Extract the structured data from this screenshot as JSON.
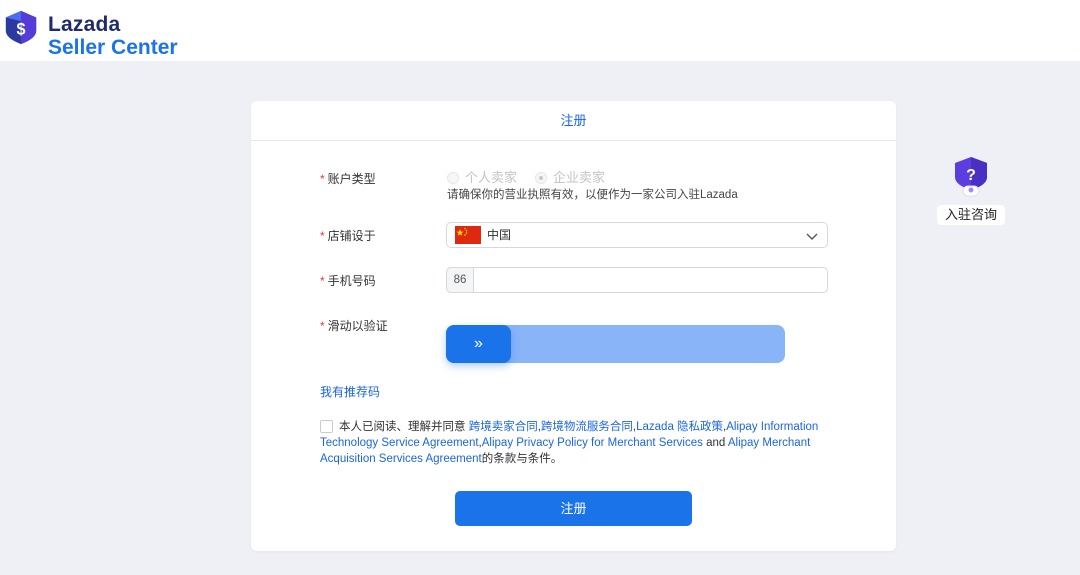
{
  "brand": {
    "line1": "Lazada",
    "line2": "Seller Center",
    "colors": {
      "dark": "#1f2b6b",
      "blue": "#1a73e8"
    }
  },
  "form": {
    "title": "注册",
    "account_type": {
      "label": "账户类型",
      "options": [
        "个人卖家",
        "企业卖家"
      ],
      "selected": "企业卖家",
      "hint": "请确保你的营业执照有效，以便作为一家公司入驻Lazada"
    },
    "store_location": {
      "label": "店铺设于",
      "value": "中国",
      "flag_icon": "china-flag-icon"
    },
    "phone": {
      "label": "手机号码",
      "prefix": "86",
      "value": "",
      "placeholder": ""
    },
    "slider": {
      "label": "滑动以验证",
      "handle_symbol": "»",
      "progress": 0
    },
    "referral_link": "我有推荐码",
    "agreement": {
      "prefix": "本人已阅读、理解并同意 ",
      "link1": "跨境卖家合同",
      "sep1": ",",
      "link2": "跨境物流服务合同",
      "sep2": ",",
      "link3": "Lazada 隐私政策",
      "sep3": ",",
      "link4": "Alipay Information Technology Service Agreement",
      "sep4": ",",
      "link5": "Alipay Privacy Policy for Merchant Services",
      "and": " and ",
      "link6": "Alipay Merchant Acquisition Services Agreement",
      "suffix": "的条款与条件。"
    },
    "submit_label": "注册",
    "required_mark": "*"
  },
  "consult": {
    "label": "入驻咨询",
    "icon": "question-icon"
  },
  "colors": {
    "background": "#eff0f5",
    "primary": "#1a73e8",
    "link": "#1a66e0",
    "required": "#e23b3b",
    "slider_track": "#8ab4f8"
  }
}
